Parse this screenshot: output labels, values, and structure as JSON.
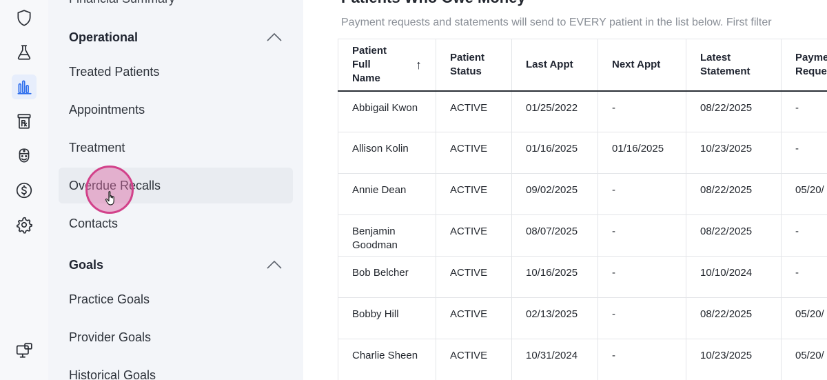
{
  "rail": {
    "icons": [
      "shield-icon",
      "flask-icon",
      "bar-chart-icon",
      "prescription-icon",
      "doctor-icon",
      "dollar-icon",
      "gear-icon"
    ],
    "bottom_icon": "monitor-icon",
    "active": "bar-chart-icon",
    "active_color": "#2f6fed"
  },
  "menu": {
    "cut_item": "Financial Summary",
    "sections": [
      {
        "title": "Operational",
        "items": [
          "Treated Patients",
          "Appointments",
          "Treatment",
          "Overdue Recalls",
          "Contacts"
        ]
      },
      {
        "title": "Goals",
        "items": [
          "Practice Goals",
          "Provider Goals",
          "Historical Goals"
        ]
      }
    ],
    "hovered_item": "Overdue Recalls",
    "cursor_color": "#d2418a"
  },
  "main": {
    "title": "Patients Who Owe Money",
    "subtitle": "Payment requests and statements will send to EVERY patient in the list below. First filter",
    "table": {
      "columns": [
        "Patient Full Name",
        "Patient Status",
        "Last Appt",
        "Next Appt",
        "Latest Statement",
        "Payment Request"
      ],
      "sort_column": "Patient Full Name",
      "sort_arrow": "↑",
      "rows": [
        [
          "Abbigail Kwon",
          "ACTIVE",
          "01/25/2022",
          "-",
          "08/22/2025",
          "-"
        ],
        [
          "Allison Kolin",
          "ACTIVE",
          "01/16/2025",
          "01/16/2025",
          "10/23/2025",
          "-"
        ],
        [
          "Annie Dean",
          "ACTIVE",
          "09/02/2025",
          "-",
          "08/22/2025",
          "05/20/"
        ],
        [
          "Benjamin Goodman",
          "ACTIVE",
          "08/07/2025",
          "-",
          "08/22/2025",
          "-"
        ],
        [
          "Bob Belcher",
          "ACTIVE",
          "10/16/2025",
          "-",
          "10/10/2024",
          "-"
        ],
        [
          "Bobby Hill",
          "ACTIVE",
          "02/13/2025",
          "-",
          "08/22/2025",
          "05/20/"
        ],
        [
          "Charlie Sheen",
          "ACTIVE",
          "10/31/2024",
          "-",
          "10/23/2025",
          "05/20/"
        ]
      ]
    }
  }
}
